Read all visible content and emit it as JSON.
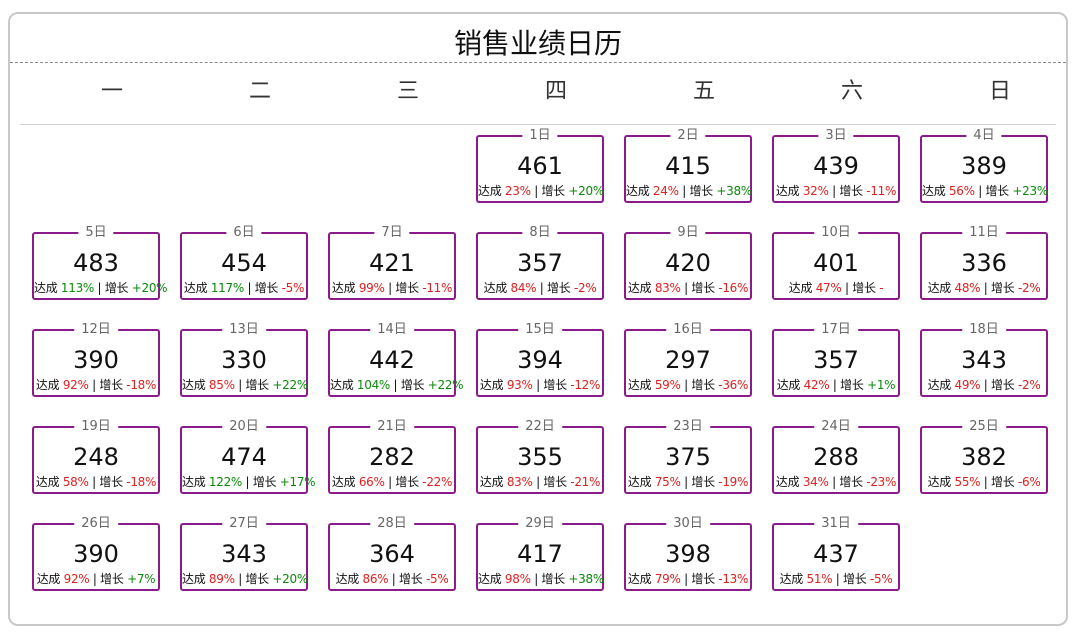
{
  "title": "销售业绩日历",
  "weekdays": [
    "一",
    "二",
    "三",
    "四",
    "五",
    "六",
    "日"
  ],
  "labels": {
    "achieve": "达成",
    "growth": "增长",
    "separator": "|"
  },
  "colors": {
    "border": "#8b1a8b",
    "negative": "#e02020",
    "positive": "#0a8a0a"
  },
  "days": [
    {
      "day": "1日",
      "value": "461",
      "achieve": "23%",
      "growth": "+20%"
    },
    {
      "day": "2日",
      "value": "415",
      "achieve": "24%",
      "growth": "+38%"
    },
    {
      "day": "3日",
      "value": "439",
      "achieve": "32%",
      "growth": "-11%"
    },
    {
      "day": "4日",
      "value": "389",
      "achieve": "56%",
      "growth": "+23%"
    },
    {
      "day": "5日",
      "value": "483",
      "achieve": "113%",
      "growth": "+20%"
    },
    {
      "day": "6日",
      "value": "454",
      "achieve": "117%",
      "growth": "-5%"
    },
    {
      "day": "7日",
      "value": "421",
      "achieve": "99%",
      "growth": "-11%"
    },
    {
      "day": "8日",
      "value": "357",
      "achieve": "84%",
      "growth": "-2%"
    },
    {
      "day": "9日",
      "value": "420",
      "achieve": "83%",
      "growth": "-16%"
    },
    {
      "day": "10日",
      "value": "401",
      "achieve": "47%",
      "growth": "-"
    },
    {
      "day": "11日",
      "value": "336",
      "achieve": "48%",
      "growth": "-2%"
    },
    {
      "day": "12日",
      "value": "390",
      "achieve": "92%",
      "growth": "-18%"
    },
    {
      "day": "13日",
      "value": "330",
      "achieve": "85%",
      "growth": "+22%"
    },
    {
      "day": "14日",
      "value": "442",
      "achieve": "104%",
      "growth": "+22%"
    },
    {
      "day": "15日",
      "value": "394",
      "achieve": "93%",
      "growth": "-12%"
    },
    {
      "day": "16日",
      "value": "297",
      "achieve": "59%",
      "growth": "-36%"
    },
    {
      "day": "17日",
      "value": "357",
      "achieve": "42%",
      "growth": "+1%"
    },
    {
      "day": "18日",
      "value": "343",
      "achieve": "49%",
      "growth": "-2%"
    },
    {
      "day": "19日",
      "value": "248",
      "achieve": "58%",
      "growth": "-18%"
    },
    {
      "day": "20日",
      "value": "474",
      "achieve": "122%",
      "growth": "+17%"
    },
    {
      "day": "21日",
      "value": "282",
      "achieve": "66%",
      "growth": "-22%"
    },
    {
      "day": "22日",
      "value": "355",
      "achieve": "83%",
      "growth": "-21%"
    },
    {
      "day": "23日",
      "value": "375",
      "achieve": "75%",
      "growth": "-19%"
    },
    {
      "day": "24日",
      "value": "288",
      "achieve": "34%",
      "growth": "-23%"
    },
    {
      "day": "25日",
      "value": "382",
      "achieve": "55%",
      "growth": "-6%"
    },
    {
      "day": "26日",
      "value": "390",
      "achieve": "92%",
      "growth": "+7%"
    },
    {
      "day": "27日",
      "value": "343",
      "achieve": "89%",
      "growth": "+20%"
    },
    {
      "day": "28日",
      "value": "364",
      "achieve": "86%",
      "growth": "-5%"
    },
    {
      "day": "29日",
      "value": "417",
      "achieve": "98%",
      "growth": "+38%"
    },
    {
      "day": "30日",
      "value": "398",
      "achieve": "79%",
      "growth": "-13%"
    },
    {
      "day": "31日",
      "value": "437",
      "achieve": "51%",
      "growth": "-5%"
    }
  ]
}
